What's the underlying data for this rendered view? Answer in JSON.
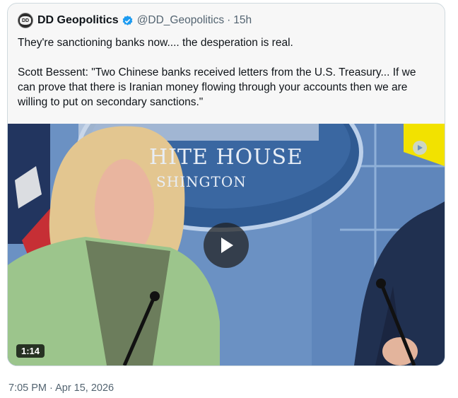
{
  "tweet": {
    "display_name": "DD Geopolitics",
    "handle": "@DD_Geopolitics",
    "separator": "·",
    "age": "15h",
    "avatar_text": "DD",
    "body_line": "They're sanctioning banks now.... the desperation is real.",
    "quote": "Scott Bessent: \"Two Chinese banks received letters from the U.S. Treasury... If we can prove that there is Iranian money flowing through your accounts then we are willing to put on secondary sanctions.\"",
    "timestamp": "7:05 PM · Apr 15, 2026"
  },
  "video": {
    "duration": "1:14",
    "backdrop_line1": "HITE HOUSE",
    "backdrop_line2": "SHINGTON",
    "play_icon": "play-icon",
    "colors": {
      "accent": "#1d9bf0",
      "blazer": "#9cc58c",
      "backdrop": "#6f96c8"
    }
  }
}
